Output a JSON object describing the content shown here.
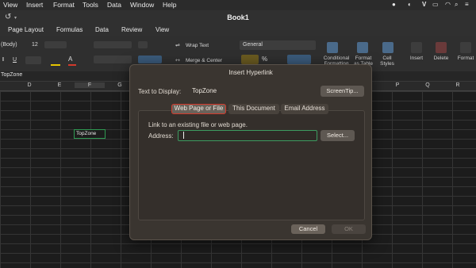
{
  "menubar": {
    "items": [
      "View",
      "Insert",
      "Format",
      "Tools",
      "Data",
      "Window",
      "Help"
    ],
    "status_icons": [
      "line-app-icon",
      "vivaldi-icon",
      "v-icon",
      "battery-icon",
      "wifi-icon",
      "search-icon",
      "control-center-icon"
    ]
  },
  "window": {
    "title": "Book1"
  },
  "ribbon": {
    "tabs": [
      "Page Layout",
      "Formulas",
      "Data",
      "Review",
      "View"
    ],
    "font_name": "(Body)",
    "font_size": "12",
    "wrap_text": "Wrap Text",
    "merge_center": "Merge & Center",
    "number_format": "General",
    "conditional_formatting": "Conditional Formatting",
    "format_as_table": "Format as Table",
    "cell_styles": "Cell Styles",
    "insert": "Insert",
    "delete": "Delete",
    "format": "Format"
  },
  "formula_bar": {
    "name_box": "TopZone"
  },
  "grid": {
    "columns": [
      "D",
      "E",
      "F",
      "G",
      "P",
      "Q",
      "R"
    ],
    "selected_cell_text": "TopZone"
  },
  "dialog": {
    "title": "Insert Hyperlink",
    "text_to_display_label": "Text to Display:",
    "text_to_display_value": "TopZone",
    "screentip_button": "ScreenTip...",
    "tabs": [
      "Web Page or File",
      "This Document",
      "Email Address"
    ],
    "active_tab": "Web Page or File",
    "instruction": "Link to an existing file or web page.",
    "address_label": "Address:",
    "address_value": "",
    "select_button": "Select...",
    "cancel_button": "Cancel",
    "ok_button": "OK"
  },
  "colors": {
    "accent_highlight": "#d23a2c",
    "focus_ring": "#2f9a52",
    "dialog_bg": "#3a3530"
  }
}
